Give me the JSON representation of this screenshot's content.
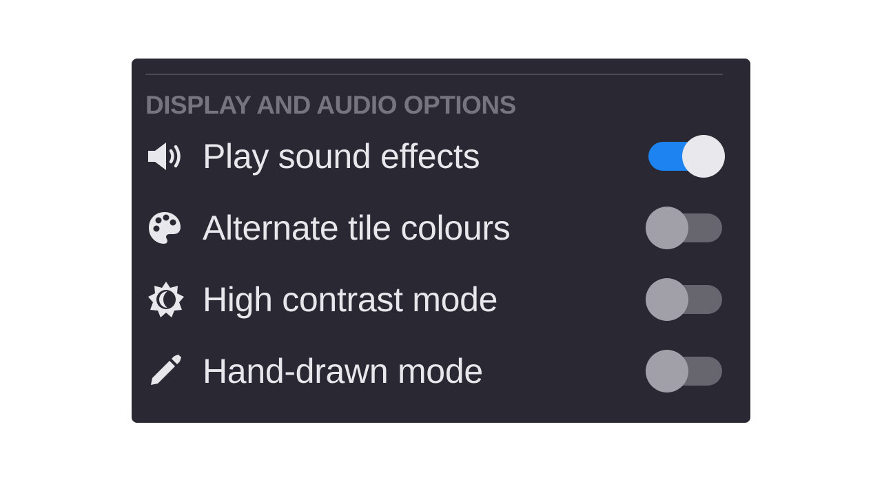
{
  "panel": {
    "section_title": "DISPLAY AND AUDIO OPTIONS",
    "options": [
      {
        "label": "Play sound effects",
        "icon": "speaker-icon",
        "enabled": true
      },
      {
        "label": "Alternate tile colours",
        "icon": "palette-icon",
        "enabled": false
      },
      {
        "label": "High contrast mode",
        "icon": "contrast-sun-moon-icon",
        "enabled": false
      },
      {
        "label": "Hand-drawn mode",
        "icon": "pencil-icon",
        "enabled": false
      }
    ]
  },
  "colors": {
    "panel_background": "#292833",
    "toggle_on": "#1d83f0",
    "toggle_off_track": "#67666f",
    "text": "#e8e7ec",
    "section_title": "#75747f"
  }
}
